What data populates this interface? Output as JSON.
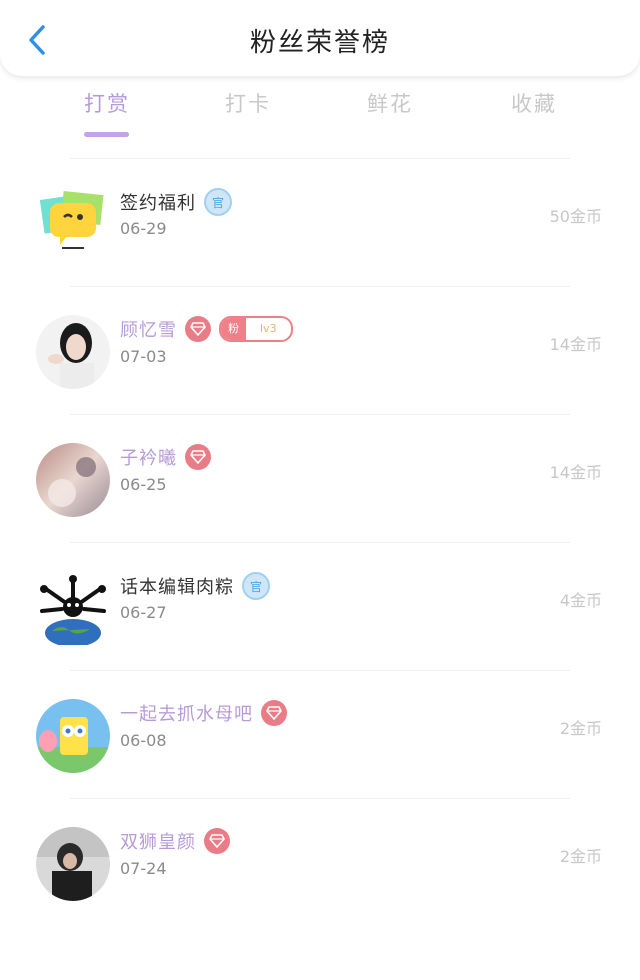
{
  "header": {
    "title": "粉丝荣誉榜"
  },
  "tabs": [
    {
      "label": "打赏",
      "active": true
    },
    {
      "label": "打卡",
      "active": false
    },
    {
      "label": "鲜花",
      "active": false
    },
    {
      "label": "收藏",
      "active": false
    }
  ],
  "colors": {
    "accent": "#b79bd8",
    "official_badge": "#9fd0f4",
    "diamond_badge": "#e97c86"
  },
  "rows": [
    {
      "name": "签约福利",
      "name_purple": false,
      "badge": "official",
      "badge_text": "官",
      "date": "06-29",
      "amount": "50金币",
      "avatar_icon": "speech-bubble-icon"
    },
    {
      "name": "顾忆雪",
      "name_purple": true,
      "badge": "diamond",
      "fan_badge": {
        "left": "粉",
        "right": "lv3"
      },
      "date": "07-03",
      "amount": "14金币",
      "avatar_icon": "user-photo-icon"
    },
    {
      "name": "子衿曦",
      "name_purple": true,
      "badge": "diamond",
      "date": "06-25",
      "amount": "14金币",
      "avatar_icon": "user-photo-icon"
    },
    {
      "name": "话本编辑肉粽",
      "name_purple": false,
      "badge": "official",
      "badge_text": "官",
      "date": "06-27",
      "amount": "4金币",
      "avatar_icon": "earth-icon"
    },
    {
      "name": "一起去抓水母吧",
      "name_purple": true,
      "badge": "diamond",
      "date": "06-08",
      "amount": "2金币",
      "avatar_icon": "cartoon-icon"
    },
    {
      "name": "双狮皇颜",
      "name_purple": true,
      "badge": "diamond",
      "date": "07-24",
      "amount": "2金币",
      "avatar_icon": "user-photo-icon"
    }
  ]
}
